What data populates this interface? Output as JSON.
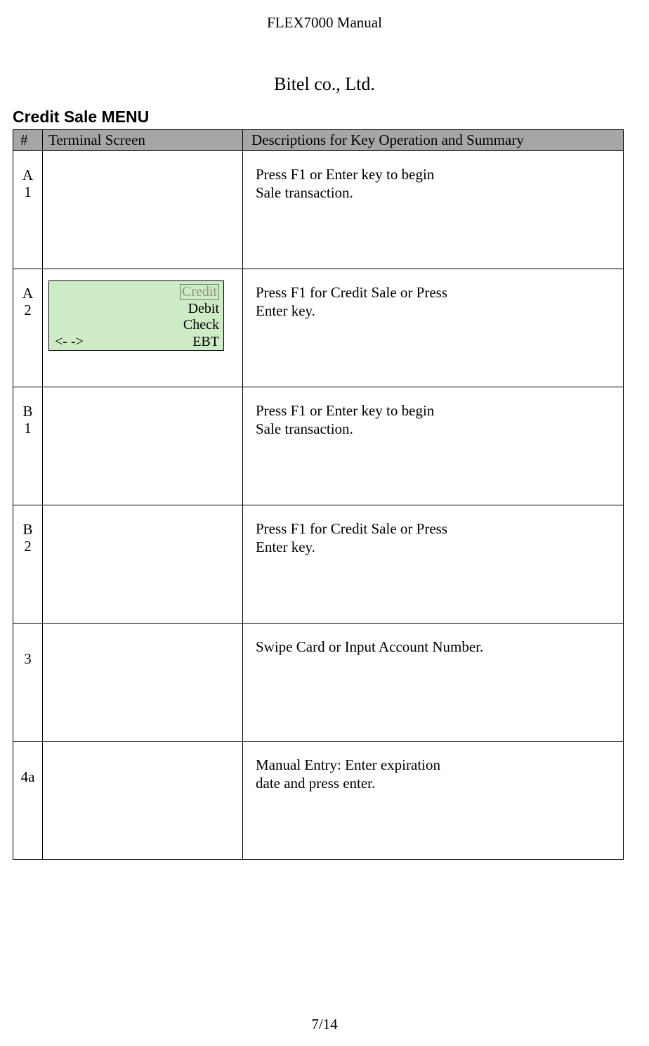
{
  "doc_header": "FLEX7000 Manual",
  "company": "Bitel co., Ltd.",
  "section_title": "Credit Sale MENU",
  "table": {
    "headers": {
      "num": "#",
      "terminal": "Terminal Screen",
      "desc": "Descriptions for Key Operation and Summary"
    },
    "rows": [
      {
        "num_a": "A",
        "num_b": "1",
        "terminal": null,
        "desc_l1": "Press F1 or Enter key to begin",
        "desc_l2": "Sale transaction."
      },
      {
        "num_a": "A",
        "num_b": "2",
        "terminal": {
          "line1": "Credit",
          "line2": "Debit",
          "line3": "Check",
          "nav": "<-    ->",
          "line4": "EBT"
        },
        "desc_l1": "Press F1 for Credit Sale or Press",
        "desc_l2": "Enter key."
      },
      {
        "num_a": "B",
        "num_b": "1",
        "terminal": null,
        "desc_l1": "Press F1 or Enter key to begin",
        "desc_l2": "Sale transaction."
      },
      {
        "num_a": "B",
        "num_b": "2",
        "terminal": null,
        "desc_l1": "Press F1 for Credit Sale or Press",
        "desc_l2": "Enter key."
      },
      {
        "num_a": "",
        "num_b": "3",
        "terminal": null,
        "desc_l1": "Swipe Card or Input Account Number.",
        "desc_l2": ""
      },
      {
        "num_a": "",
        "num_b": "4a",
        "terminal": null,
        "desc_l1": "Manual Entry:  Enter expiration",
        "desc_l2": "date and press enter."
      }
    ]
  },
  "page_number": "7/14"
}
